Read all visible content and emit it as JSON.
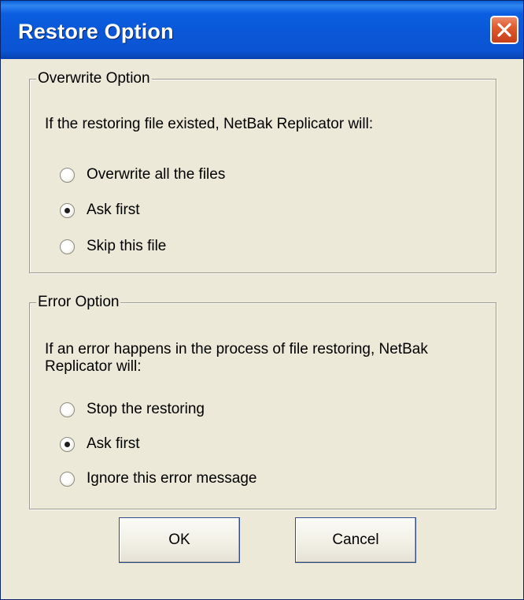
{
  "window": {
    "title": "Restore Option"
  },
  "overwrite": {
    "legend": "Overwrite Option",
    "description": "If the restoring file existed, NetBak Replicator will:",
    "options": [
      {
        "label": "Overwrite all the files",
        "checked": false
      },
      {
        "label": "Ask first",
        "checked": true
      },
      {
        "label": "Skip this file",
        "checked": false
      }
    ]
  },
  "error": {
    "legend": "Error Option",
    "description_line1": "If an error happens in the process of file restoring, NetBak",
    "description_line2": "Replicator will:",
    "options": [
      {
        "label": "Stop the restoring",
        "checked": false
      },
      {
        "label": "Ask first",
        "checked": true
      },
      {
        "label": "Ignore this error message",
        "checked": false
      }
    ]
  },
  "buttons": {
    "ok_label": "OK",
    "cancel_label": "Cancel"
  },
  "icons": {
    "close": "close-icon"
  }
}
